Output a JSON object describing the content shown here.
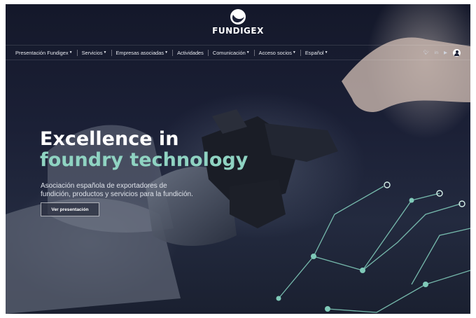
{
  "brand": {
    "name": "FUNDIGEX"
  },
  "nav": {
    "items": [
      {
        "label": "Presentación Fundigex",
        "dropdown": true
      },
      {
        "label": "Servicios",
        "dropdown": true
      },
      {
        "label": "Empresas asociadas",
        "dropdown": true
      },
      {
        "label": "Actividades",
        "dropdown": false
      },
      {
        "label": "Comunicación",
        "dropdown": true
      },
      {
        "label": "Acceso socios",
        "dropdown": true
      },
      {
        "label": "Español",
        "dropdown": true
      }
    ],
    "social_icons": [
      "twitter-icon",
      "linkedin-icon",
      "youtube-icon"
    ],
    "user_icon": "user-account-icon"
  },
  "hero": {
    "headline_line1": "Excellence in",
    "headline_line2": "foundry technology",
    "subtitle_line1": "Asociación española de exportadores de",
    "subtitle_line2": "fundición, productos y servicios para la fundición.",
    "cta_label": "Ver presentación"
  },
  "colors": {
    "accent": "#8fd3c2",
    "background": "#1b2036",
    "text": "#ffffff"
  }
}
